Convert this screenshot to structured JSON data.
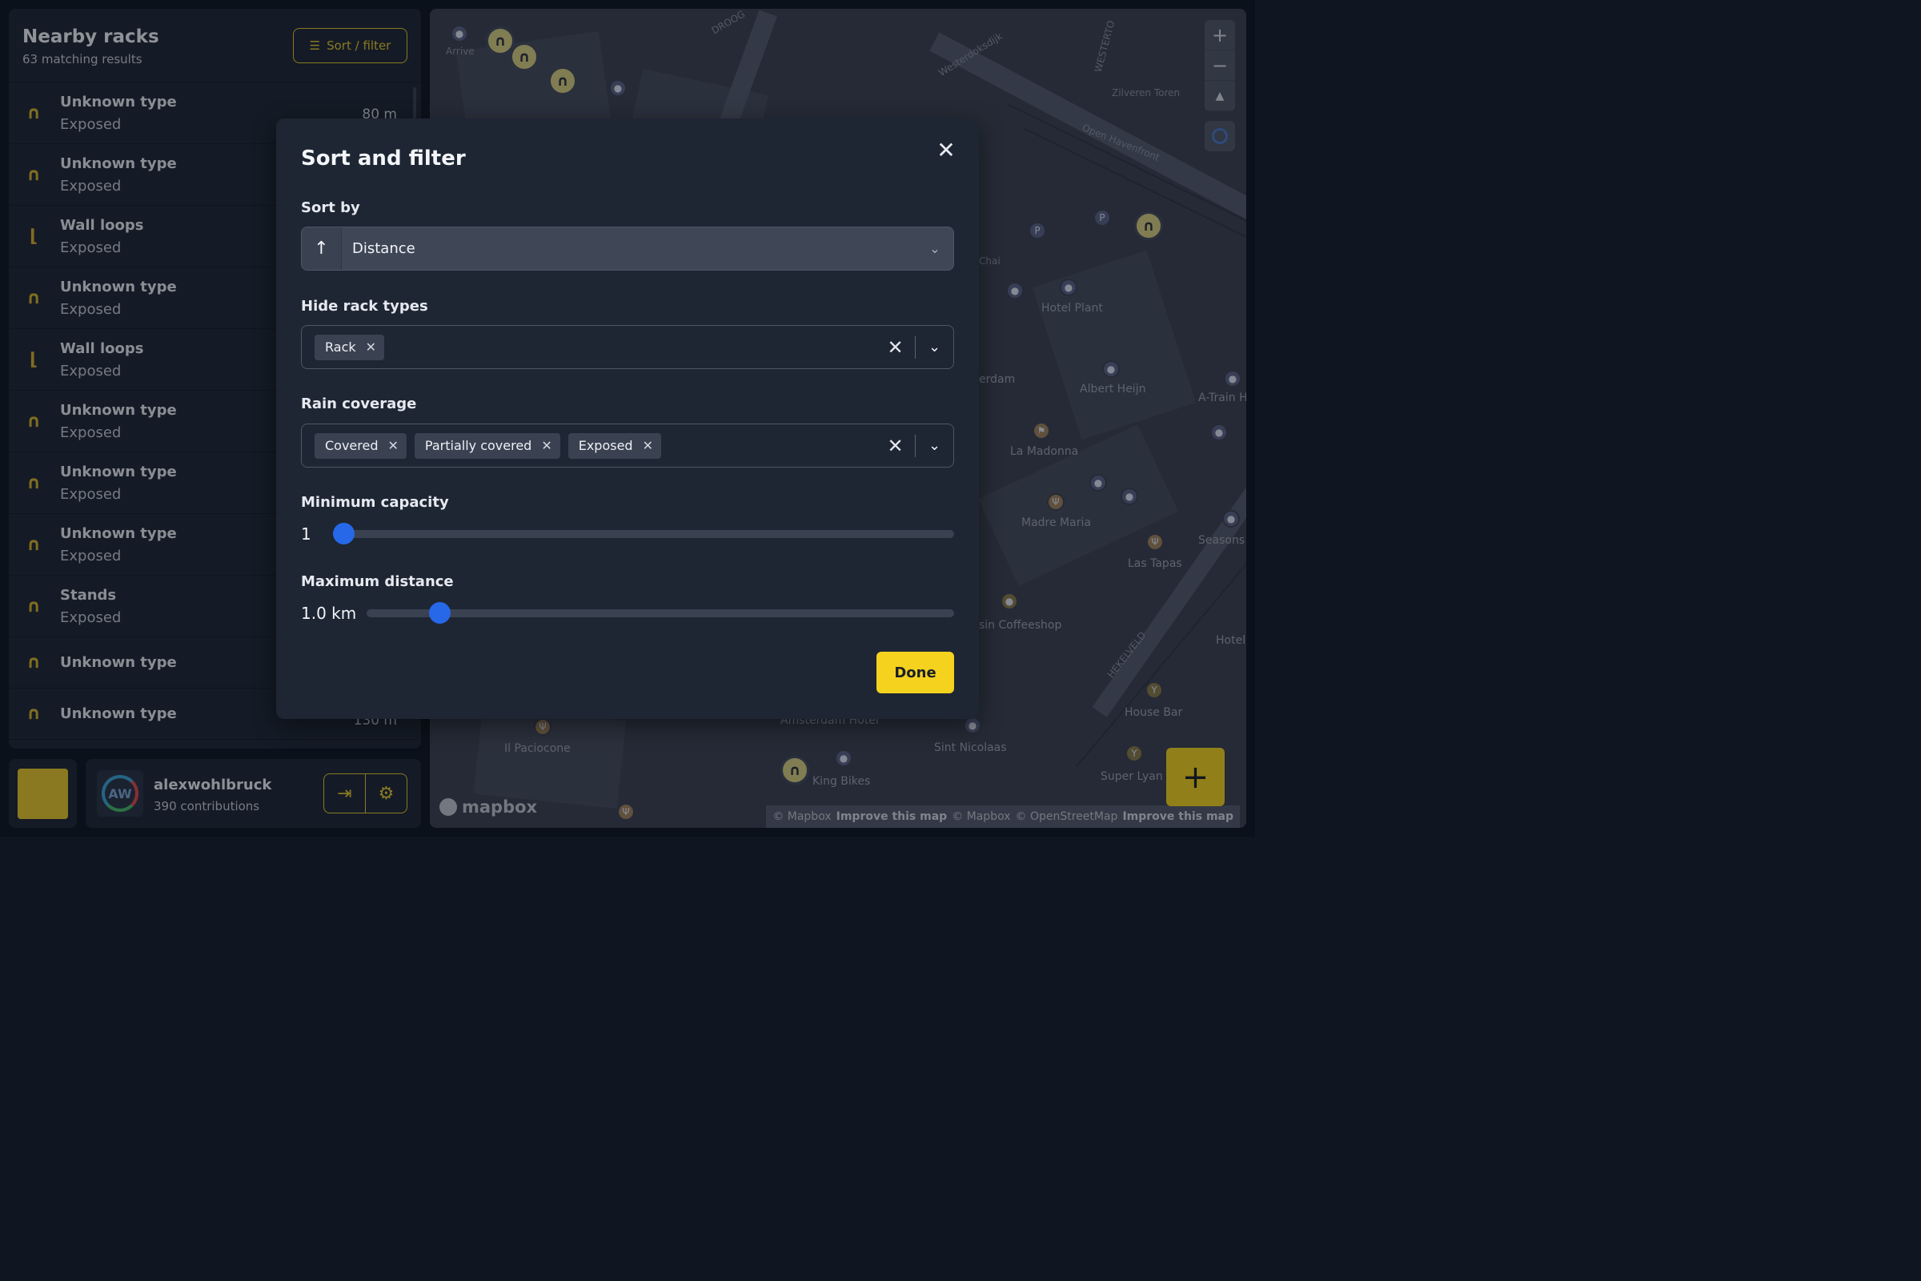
{
  "sidebar": {
    "title": "Nearby racks",
    "subtitle": "63 matching results",
    "sort_filter_label": "Sort / filter",
    "items": [
      {
        "type": "Unknown type",
        "coverage": "Exposed",
        "distance": "80 m",
        "icon": "rack-icon"
      },
      {
        "type": "Unknown type",
        "coverage": "Exposed",
        "distance": "",
        "icon": "rack-icon"
      },
      {
        "type": "Wall loops",
        "coverage": "Exposed",
        "distance": "",
        "icon": "wall-loop-icon"
      },
      {
        "type": "Unknown type",
        "coverage": "Exposed",
        "distance": "",
        "icon": "rack-icon"
      },
      {
        "type": "Wall loops",
        "coverage": "Exposed",
        "distance": "",
        "icon": "wall-loop-icon"
      },
      {
        "type": "Unknown type",
        "coverage": "Exposed",
        "distance": "",
        "icon": "rack-icon"
      },
      {
        "type": "Unknown type",
        "coverage": "Exposed",
        "distance": "",
        "icon": "rack-icon"
      },
      {
        "type": "Unknown type",
        "coverage": "Exposed",
        "distance": "",
        "icon": "rack-icon"
      },
      {
        "type": "Stands",
        "coverage": "Exposed",
        "distance": "",
        "icon": "rack-icon"
      },
      {
        "type": "Unknown type",
        "coverage": "",
        "distance": "",
        "icon": "rack-icon"
      },
      {
        "type": "Unknown type",
        "coverage": "",
        "distance": "130 m",
        "icon": "rack-icon"
      }
    ]
  },
  "user": {
    "username": "alexwohlbruck",
    "contributions": "390 contributions",
    "initials": "AW"
  },
  "map": {
    "labels": [
      "Arrive",
      "Zilveren Toren",
      "Open Havenfront",
      "Westerdoksdijk",
      "Hotel Plant",
      "Albert Heijn",
      "A-Train H",
      "La Madonna",
      "Madre Maria",
      "Las Tapas",
      "Seasons",
      "Hotel",
      "House Bar",
      "Super Lyan",
      "Sint Nicolaas",
      "King Bikes",
      "Amsterdam Hotel",
      "Il Paciocone",
      "sin Coffeeshop",
      "erdam",
      "Chai",
      "HEKELVELD",
      "WESTERTO",
      "DROOG"
    ],
    "attribution": {
      "mapbox": "© Mapbox",
      "improve": "Improve this map",
      "osm": "© OpenStreetMap"
    },
    "logo": "mapbox",
    "zoom_in": "+",
    "zoom_out": "−",
    "compass": "▲",
    "fab": "+"
  },
  "modal": {
    "title": "Sort and filter",
    "close": "✕",
    "sort_by_label": "Sort by",
    "sort_direction": "↑",
    "sort_value": "Distance",
    "hide_types_label": "Hide rack types",
    "hide_types_chips": [
      "Rack"
    ],
    "rain_label": "Rain coverage",
    "rain_chips": [
      "Covered",
      "Partially covered",
      "Exposed"
    ],
    "min_capacity_label": "Minimum capacity",
    "min_capacity_value": "1",
    "min_capacity_fraction": 0.0,
    "max_distance_label": "Maximum distance",
    "max_distance_value": "1.0 km",
    "max_distance_fraction": 0.11,
    "done_label": "Done",
    "chip_remove": "✕",
    "clear": "✕",
    "caret": "⌄"
  },
  "colors": {
    "accent_yellow": "#f5d21e",
    "slider_blue": "#2768e8"
  }
}
